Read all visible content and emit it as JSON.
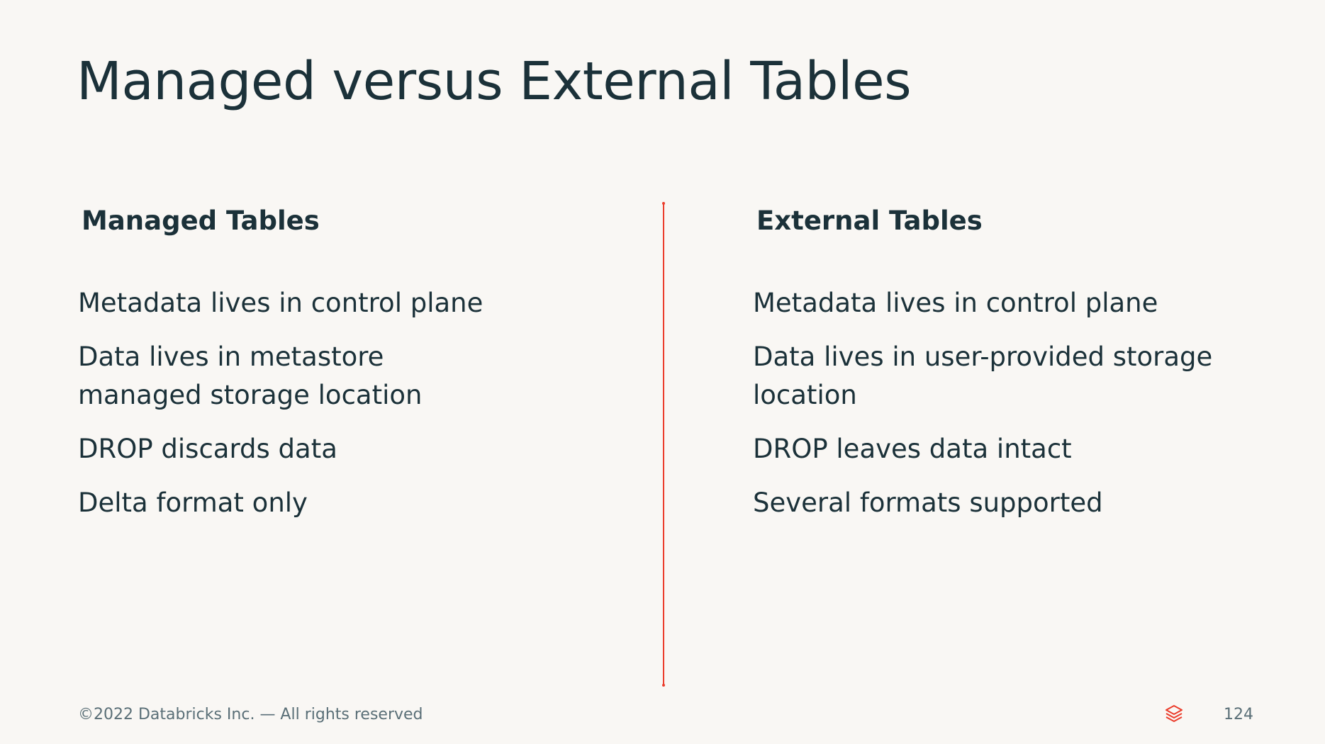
{
  "slide": {
    "title": "Managed versus External Tables",
    "accent_color": "#eb3d2c",
    "text_color": "#1b3139",
    "background_color": "#f9f7f4"
  },
  "columns": {
    "managed": {
      "heading": "Managed Tables",
      "points": [
        "Metadata lives in control plane",
        "Data lives in metastore managed storage location",
        "DROP discards data",
        "Delta format only"
      ]
    },
    "external": {
      "heading": "External Tables",
      "points": [
        "Metadata lives in control plane",
        "Data lives in user-provided storage location",
        "DROP leaves data intact",
        "Several formats supported"
      ]
    }
  },
  "footer": {
    "copyright": "©2022 Databricks Inc. — All rights reserved",
    "logo_icon": "databricks-stack-icon",
    "page_number": "124"
  }
}
